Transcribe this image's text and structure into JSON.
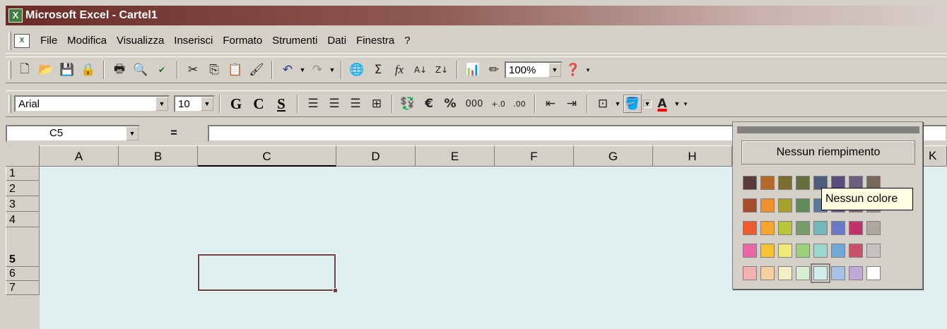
{
  "window": {
    "title": "Microsoft Excel - Cartel1",
    "app_icon": "excel-icon"
  },
  "menu": {
    "items": [
      "File",
      "Modifica",
      "Visualizza",
      "Inserisci",
      "Formato",
      "Strumenti",
      "Dati",
      "Finestra",
      "?"
    ]
  },
  "standard_toolbar": {
    "zoom": "100%",
    "icons": [
      "new-icon",
      "open-icon",
      "save-icon",
      "permission-icon",
      "print-icon",
      "print-preview-icon",
      "spelling-icon",
      "cut-icon",
      "copy-icon",
      "paste-icon",
      "format-painter-icon",
      "undo-icon",
      "redo-icon",
      "hyperlink-icon",
      "autosum-icon",
      "function-icon",
      "sort-ascending-icon",
      "sort-descending-icon",
      "chart-wizard-icon",
      "drawing-icon",
      "help-icon"
    ]
  },
  "formatting_toolbar": {
    "font": "Arial",
    "size": "10",
    "bold": "G",
    "italic": "C",
    "underline": "S",
    "percent": "%",
    "thousands": "000",
    "euro": "€",
    "fill_color": "#c0c0c0",
    "font_color": "#ff0000"
  },
  "formula_bar": {
    "name_box": "C5",
    "equals": "="
  },
  "grid": {
    "columns": [
      "A",
      "B",
      "C",
      "D",
      "E",
      "F",
      "G",
      "H"
    ],
    "rows": [
      "1",
      "2",
      "3",
      "4",
      "5",
      "6",
      "7"
    ],
    "active_cell": "C5",
    "partial_column": "K",
    "background": "#dfefef"
  },
  "fill_palette": {
    "no_fill_label": "Nessun riempimento",
    "tooltip": "Nessun colore",
    "colors": [
      [
        "#5b3a3a",
        "#b8672a",
        "#7c6d2e",
        "#656e3d",
        "#4d5d7c",
        "#5a4c7c",
        "#6d5d7c",
        "#79685a"
      ],
      [
        "#a84d29",
        "#f0902c",
        "#a8a22c",
        "#5f8c5a",
        "#5a7a9c",
        "#7a5c9a",
        "#8a6a80",
        "#9a8a8a"
      ],
      [
        "#f05b2b",
        "#f7a52c",
        "#b8c73a",
        "#7a9e6a",
        "#72b8b8",
        "#6a78c8",
        "#c0306a",
        "#b0a8a0"
      ],
      [
        "#e868a8",
        "#f7c233",
        "#f0ea7a",
        "#9cd07a",
        "#9ad8d0",
        "#70a8d8",
        "#c8506a",
        "#c8c0c0"
      ],
      [
        "#f2b0b0",
        "#f7cfa0",
        "#f4efc8",
        "#d8ecd0",
        "#d0ecec",
        "#a8c0e8",
        "#c0a8d8",
        "#ffffff"
      ]
    ],
    "selected_color": "#d0ecec"
  }
}
